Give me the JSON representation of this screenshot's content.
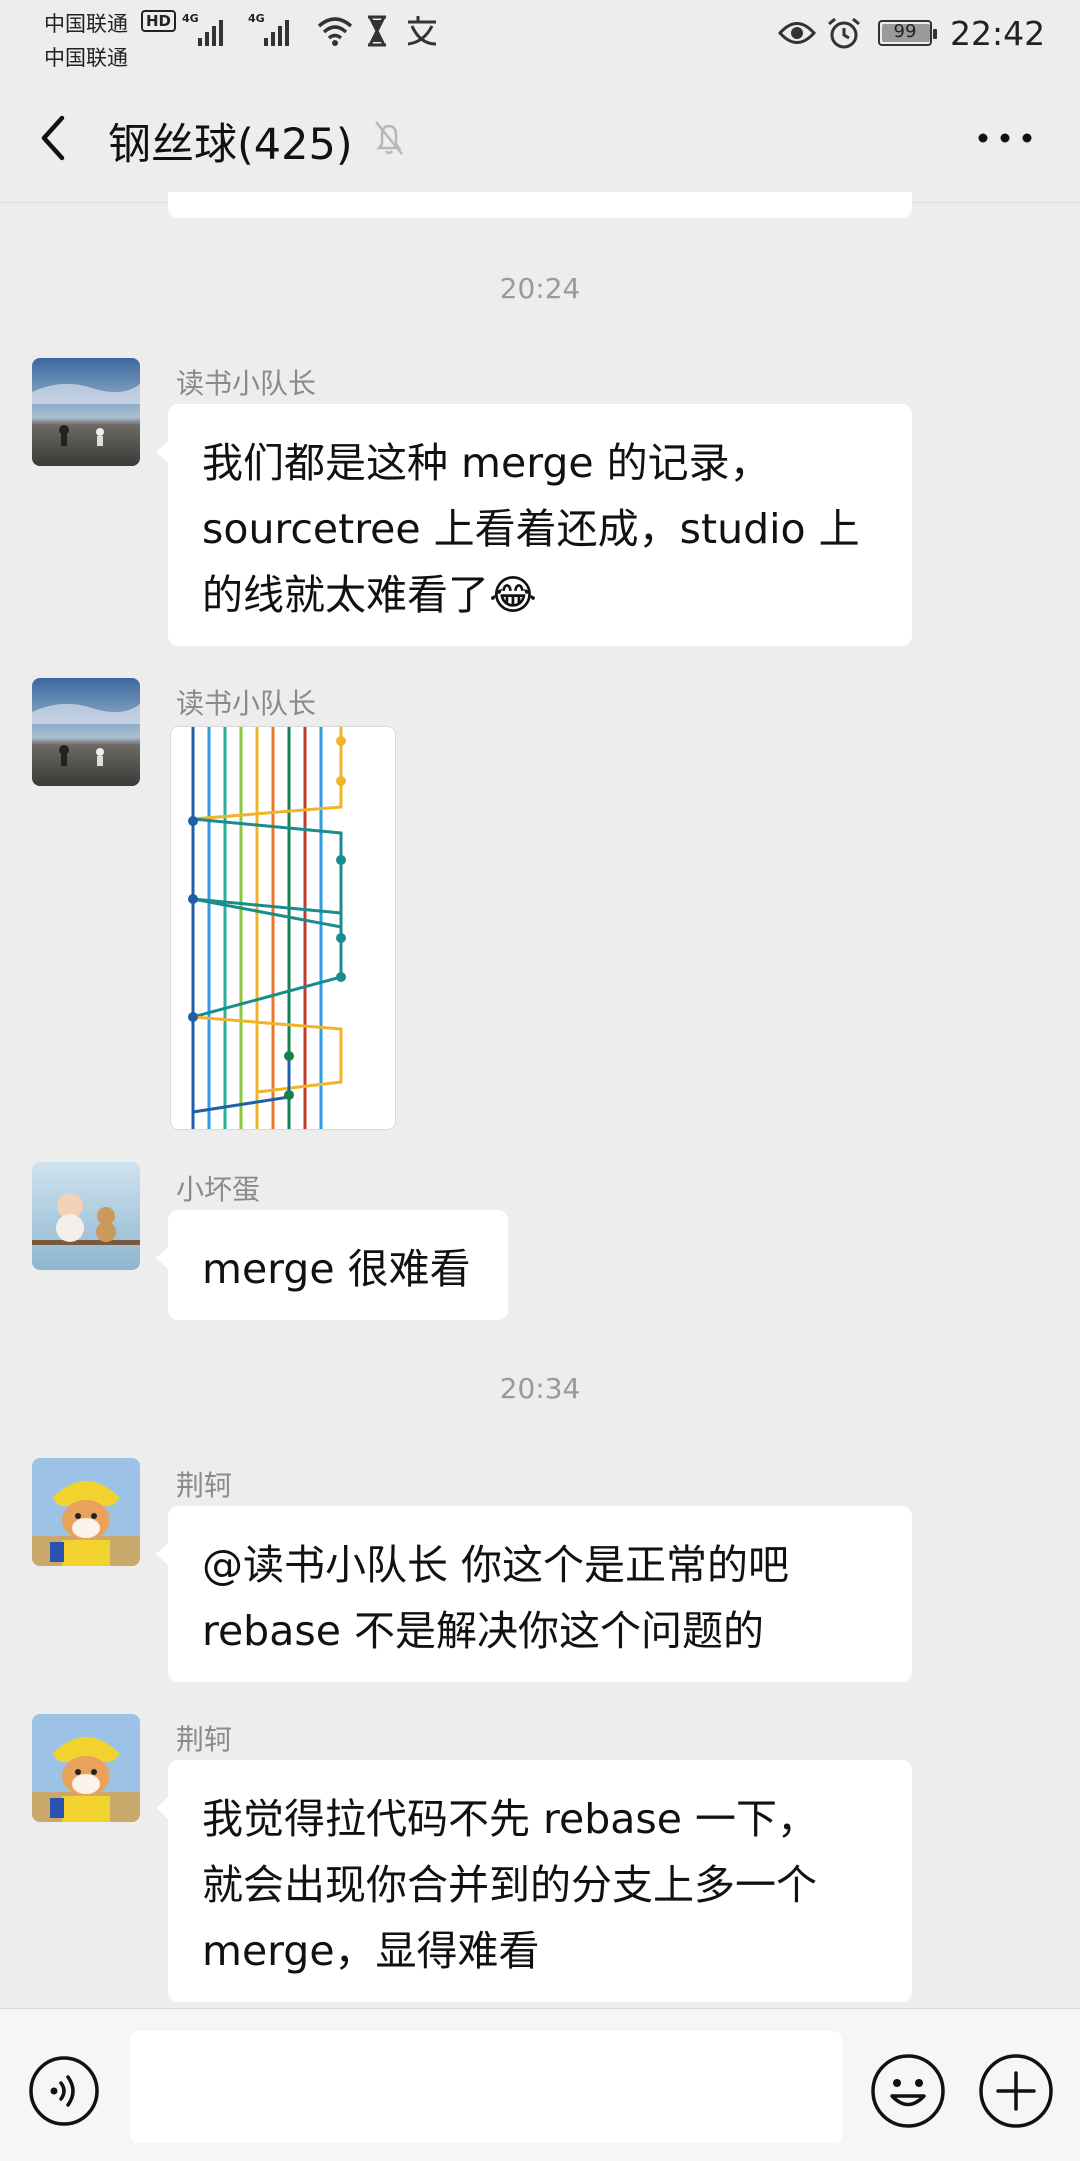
{
  "status_bar": {
    "carrier_1": "中国联通",
    "carrier_2": "中国联通",
    "hd_badge": "HD",
    "network_1": "4G",
    "network_2": "4G",
    "battery_level": "99",
    "time": "22:42",
    "icons": [
      "signal-icon",
      "wifi-icon",
      "hourglass-icon",
      "translate-icon",
      "eye-icon",
      "alarm-icon",
      "battery-icon"
    ]
  },
  "header": {
    "title": "钢丝球(425)",
    "muted": true
  },
  "messages": [
    {
      "type": "time",
      "text": "20:24"
    },
    {
      "type": "text",
      "sender": "读书小队长",
      "lines": [
        "我们都是这种 merge 的记录，",
        "sourcetree 上看着还成，studio 上",
        "的线就太难看了😂"
      ]
    },
    {
      "type": "image",
      "sender": "读书小队长",
      "content": "git-branch-graph"
    },
    {
      "type": "text",
      "sender": "小坏蛋",
      "lines": [
        "merge 很难看"
      ]
    },
    {
      "type": "time",
      "text": "20:34"
    },
    {
      "type": "text",
      "sender": "荆轲",
      "lines": [
        "@读书小队长  你这个是正常的吧",
        "rebase 不是解决你这个问题的"
      ]
    },
    {
      "type": "text",
      "sender": "荆轲",
      "lines": [
        "我觉得拉代码不先 rebase 一下，",
        "就会出现你合并到的分支上多一个",
        "merge，显得难看"
      ]
    }
  ],
  "input": {
    "value": ""
  },
  "colors": {
    "background": "#ededed",
    "bubble": "#ffffff",
    "graph_yellow": "#f0b429",
    "graph_teal": "#1a8c8c",
    "graph_blue": "#1f5fa8",
    "graph_green": "#168050"
  }
}
